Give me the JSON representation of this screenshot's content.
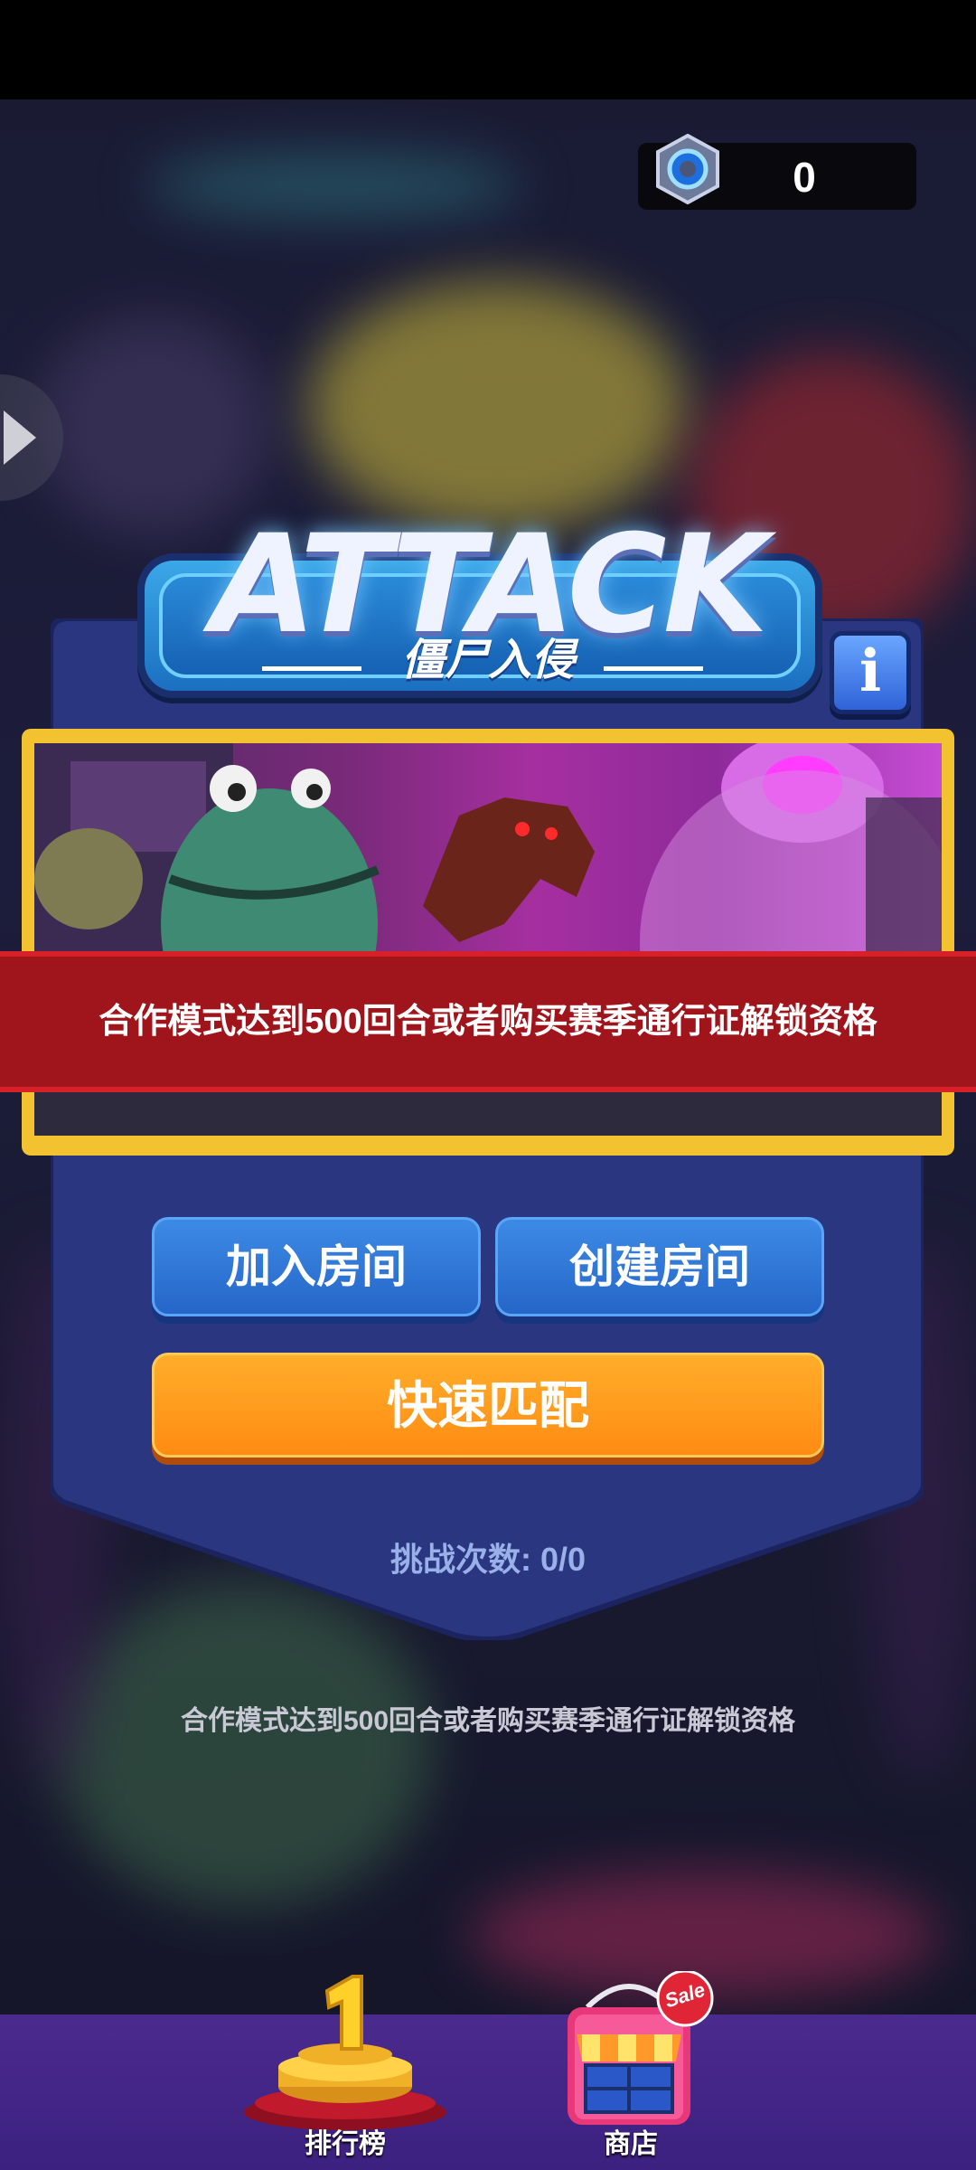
{
  "currency": {
    "icon": "gem-coin-icon",
    "value": "0"
  },
  "mode": {
    "title": "ATTACK",
    "subtitle": "僵尸入侵",
    "info_label": "i"
  },
  "lock_banner": {
    "text": "合作模式达到500回合或者购买赛季通行证解锁资格"
  },
  "buttons": {
    "join_room": "加入房间",
    "create_room": "创建房间",
    "quick_match": "快速匹配"
  },
  "challenge_count": "挑战次数: 0/0",
  "unlock_note": "合作模式达到500回合或者购买赛季通行证解锁资格",
  "bottom_nav": {
    "leaderboard": {
      "label": "排行榜",
      "icon": "trophy-icon"
    },
    "shop": {
      "label": "商店",
      "icon": "shop-icon",
      "badge": "Sale"
    }
  },
  "colors": {
    "panel": "#2a3680",
    "lock_banner": "#a0141b",
    "primary_button": "#2566c8",
    "quick_match": "#ff8c12",
    "nav_bar": "#3c2180"
  }
}
